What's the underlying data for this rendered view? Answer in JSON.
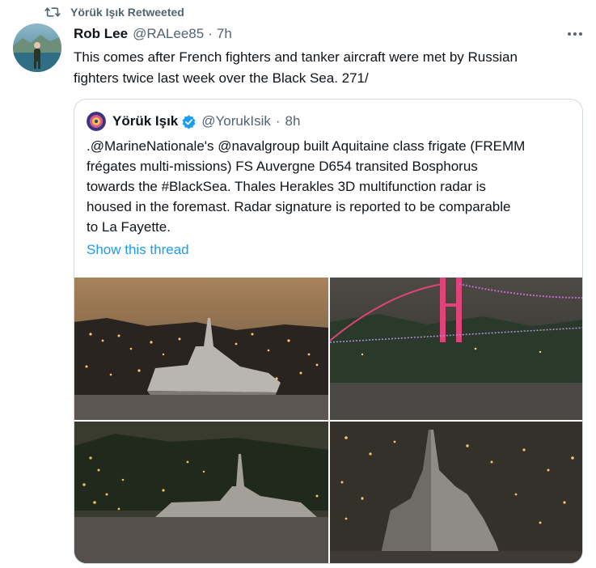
{
  "retweet": {
    "label": "Yörük Işık Retweeted"
  },
  "tweet": {
    "name": "Rob Lee",
    "handle": "@RALee85",
    "separator": "·",
    "time": "7h",
    "text_line1": "This comes after French fighters and tanker aircraft were met by Russian",
    "text_line2": "fighters twice last week over the Black Sea. 271/"
  },
  "quote": {
    "name": "Yörük Işık",
    "handle": "@YorukIsik",
    "separator": "·",
    "time": "8h",
    "lines": [
      ".@MarineNationale's @navalgroup built Aquitaine class frigate (FREMM",
      "frégates multi-missions) FS Auvergne D654 transited Bosphorus",
      "towards the #BlackSea. Thales Herakles 3D multifunction radar is",
      "housed in the foremast. Radar signature is reported to be comparable",
      "to La Fayette."
    ],
    "show_thread": "Show this thread"
  },
  "colors": {
    "link": "#1d9bf0",
    "verified": "#1d9bf0",
    "secondary_text": "#536471",
    "border": "#cfd9de"
  },
  "icons": [
    "retweet-icon",
    "more-options-icon",
    "verified-badge-icon"
  ]
}
